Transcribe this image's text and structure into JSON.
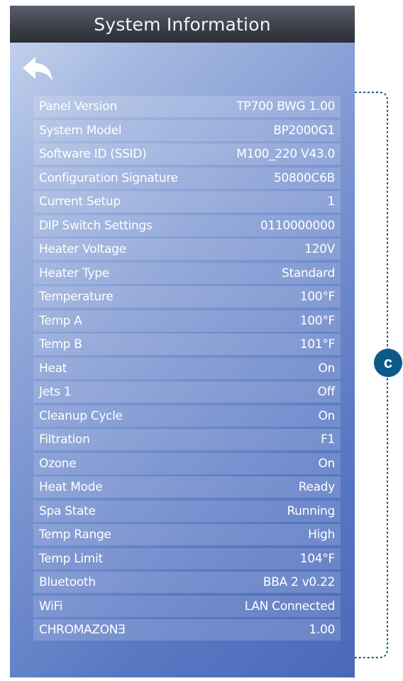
{
  "screen": {
    "title": "System Information",
    "back_icon": "back-arrow-icon",
    "rows": [
      {
        "label": "Panel Version",
        "value": "TP700 BWG 1.00"
      },
      {
        "label": "System Model",
        "value": "BP2000G1"
      },
      {
        "label": "Software ID (SSID)",
        "value": "M100_220 V43.0"
      },
      {
        "label": "Configuration Signature",
        "value": "50800C6B"
      },
      {
        "label": "Current Setup",
        "value": "1"
      },
      {
        "label": "DIP Switch Settings",
        "value": "0110000000"
      },
      {
        "label": "Heater Voltage",
        "value": "120V"
      },
      {
        "label": "Heater Type",
        "value": "Standard"
      },
      {
        "label": "Temperature",
        "value": "100°F"
      },
      {
        "label": "Temp A",
        "value": "100°F"
      },
      {
        "label": "Temp B",
        "value": "101°F"
      },
      {
        "label": "Heat",
        "value": "On"
      },
      {
        "label": "Jets 1",
        "value": "Off"
      },
      {
        "label": "Cleanup Cycle",
        "value": "On"
      },
      {
        "label": "Filtration",
        "value": "F1"
      },
      {
        "label": "Ozone",
        "value": "On"
      },
      {
        "label": "Heat Mode",
        "value": "Ready"
      },
      {
        "label": "Spa State",
        "value": "Running"
      },
      {
        "label": "Temp Range",
        "value": "High"
      },
      {
        "label": "Temp Limit",
        "value": "104°F"
      },
      {
        "label": "Bluetooth",
        "value": "BBA 2 v0.22"
      },
      {
        "label": "WiFi",
        "value": "LAN Connected"
      },
      {
        "label": "CHROMAZONƎ",
        "value": "1.00"
      }
    ]
  },
  "annotation": {
    "callout_letter": "c",
    "callout_color": "#0b5a8a",
    "bracket_color": "#0b5a8a"
  }
}
